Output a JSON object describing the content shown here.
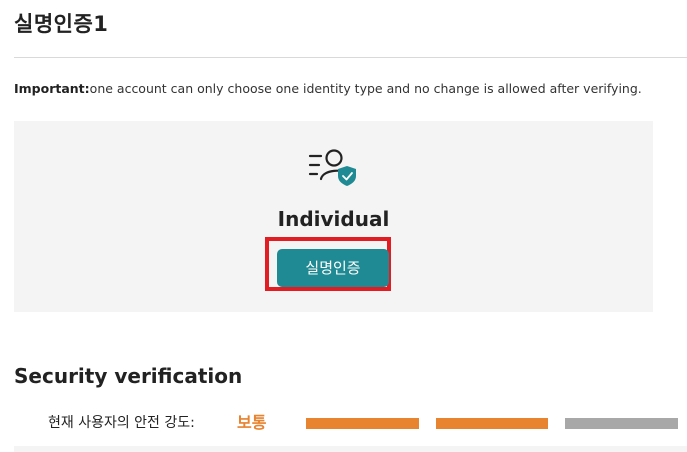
{
  "page": {
    "title": "실명인증1"
  },
  "notice": {
    "label": "Important:",
    "text": "one account can only choose one identity type and no change is allowed after verifying."
  },
  "identity_card": {
    "icon": "user-verified-icon",
    "title": "Individual",
    "button_label": "실명인증"
  },
  "security": {
    "title": "Security verification",
    "strength_label": "현재 사용자의 안전 강도:",
    "strength_value": "보통",
    "strength_level": 2,
    "strength_max": 3,
    "colors": {
      "active": "#e8832f",
      "inactive": "#a8a8a8"
    }
  },
  "colors": {
    "accent": "#1f8a93",
    "highlight": "#e21c23",
    "warning": "#e8832f"
  }
}
